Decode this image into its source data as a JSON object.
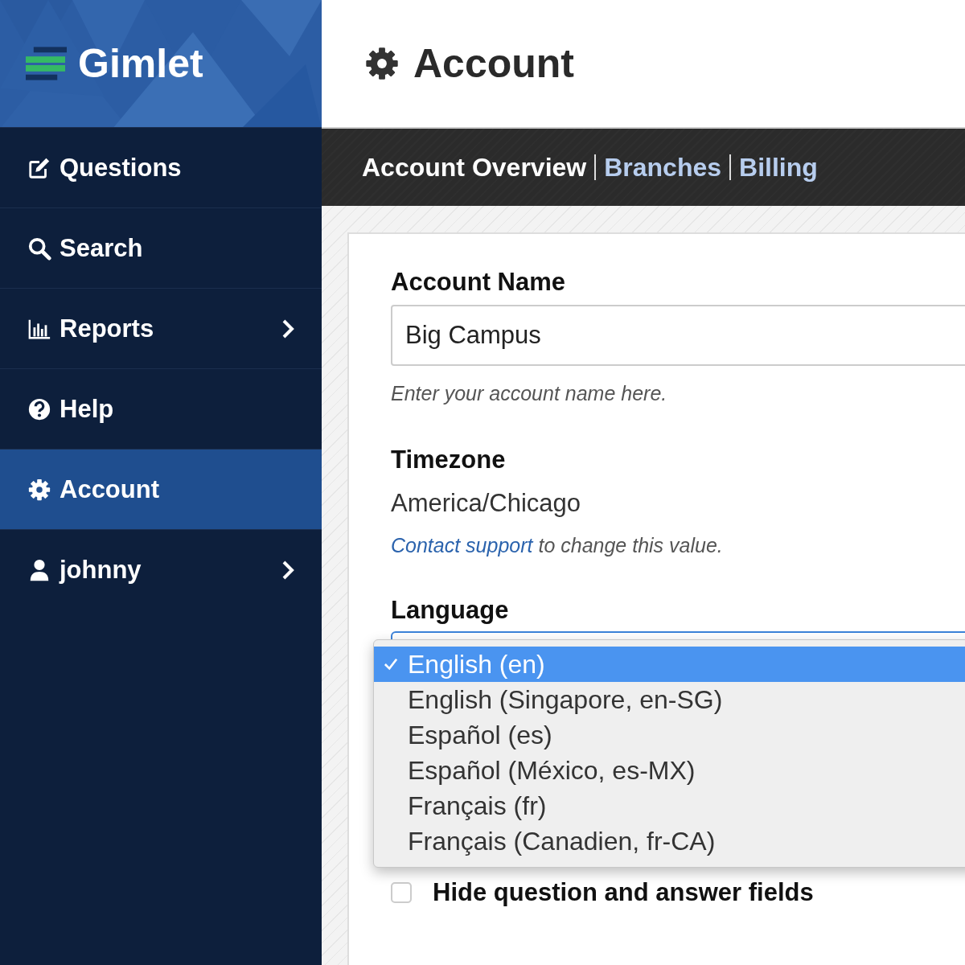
{
  "sidebar": {
    "logo": "Gimlet",
    "items": [
      {
        "label": "Questions",
        "selected": false,
        "has_submenu": false
      },
      {
        "label": "Search",
        "selected": false,
        "has_submenu": false
      },
      {
        "label": "Reports",
        "selected": false,
        "has_submenu": true
      },
      {
        "label": "Help",
        "selected": false,
        "has_submenu": false
      },
      {
        "label": "Account",
        "selected": true,
        "has_submenu": false
      },
      {
        "label": "johnny",
        "selected": false,
        "has_submenu": true
      }
    ]
  },
  "page": {
    "title": "Account"
  },
  "tabs": [
    {
      "label": "Account Overview",
      "selected": true
    },
    {
      "label": "Branches",
      "selected": false
    },
    {
      "label": "Billing",
      "selected": false
    }
  ],
  "form": {
    "account_name": {
      "label": "Account Name",
      "value": "Big Campus",
      "hint": "Enter your account name here."
    },
    "timezone": {
      "label": "Timezone",
      "value": "America/Chicago",
      "link": "Contact support",
      "note": " to change this value."
    },
    "language": {
      "label": "Language",
      "options": [
        {
          "label": "English (en)",
          "selected": true
        },
        {
          "label": "English (Singapore, en-SG)",
          "selected": false
        },
        {
          "label": "Español (es)",
          "selected": false
        },
        {
          "label": "Español (México, es-MX)",
          "selected": false
        },
        {
          "label": "Français (fr)",
          "selected": false
        },
        {
          "label": "Français (Canadien, fr-CA)",
          "selected": false
        }
      ]
    },
    "checkboxes": [
      {
        "label": "Hide question and answer fields",
        "checked": false
      }
    ]
  }
}
